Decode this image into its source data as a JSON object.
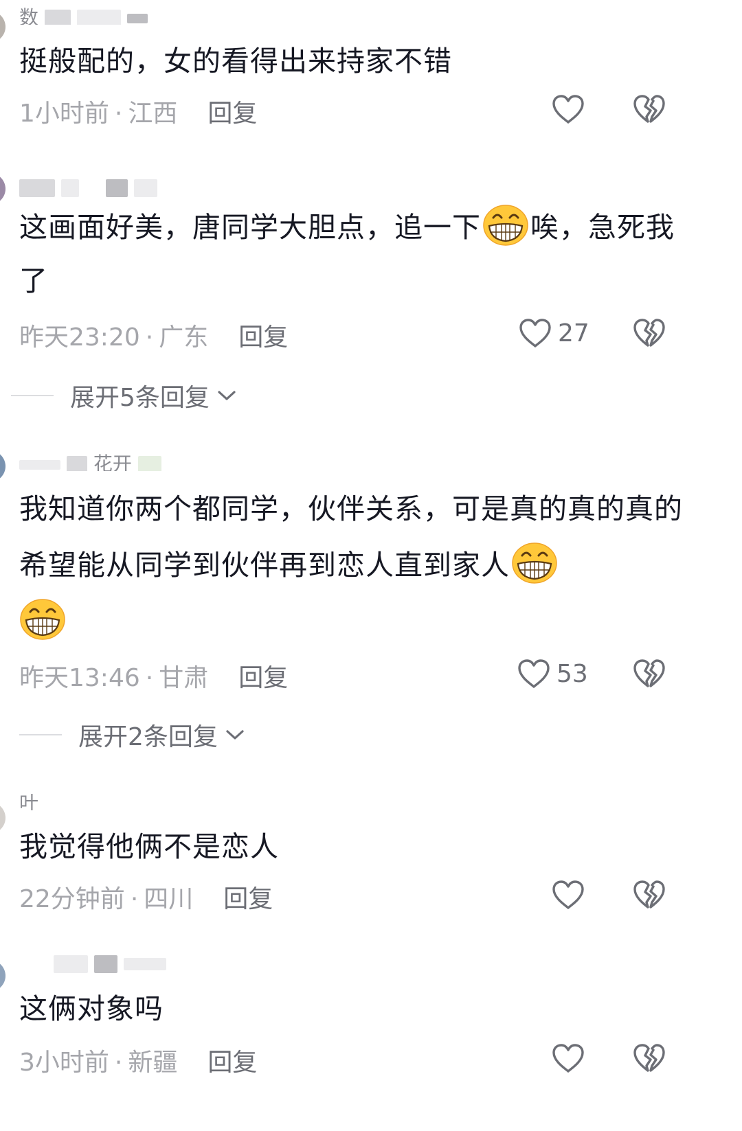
{
  "comments": [
    {
      "username": "数",
      "text": "挺般配的，女的看得出来持家不错",
      "time": "1小时前",
      "location": "江西",
      "reply_label": "回复",
      "likes": ""
    },
    {
      "username": "",
      "text_part1": "这画面好美，唐同学大胆点，追一下",
      "text_part2": "唉，急死我了",
      "time": "昨天23:20",
      "location": "广东",
      "reply_label": "回复",
      "likes": "27",
      "expand_label": "展开5条回复"
    },
    {
      "username": "花开",
      "text": "我知道你两个都同学，伙伴关系，可是真的真的真的希望能从同学到伙伴再到恋人直到家人",
      "time": "昨天13:46",
      "location": "甘肃",
      "reply_label": "回复",
      "likes": "53",
      "expand_label": "展开2条回复"
    },
    {
      "username": "叶",
      "text": "我觉得他俩不是恋人",
      "time": "22分钟前",
      "location": "四川",
      "reply_label": "回复",
      "likes": ""
    },
    {
      "username": "",
      "text": "这俩对象吗",
      "time": "3小时前",
      "location": "新疆",
      "reply_label": "回复",
      "likes": ""
    }
  ],
  "separator": "·",
  "icons": {
    "like": "heart-outline-icon",
    "dislike": "broken-heart-icon",
    "emoji": "grin-emoji-icon",
    "expand": "chevron-down-icon"
  },
  "colors": {
    "text": "#161823",
    "meta": "#a5a6ab",
    "action": "#6c6e75"
  }
}
